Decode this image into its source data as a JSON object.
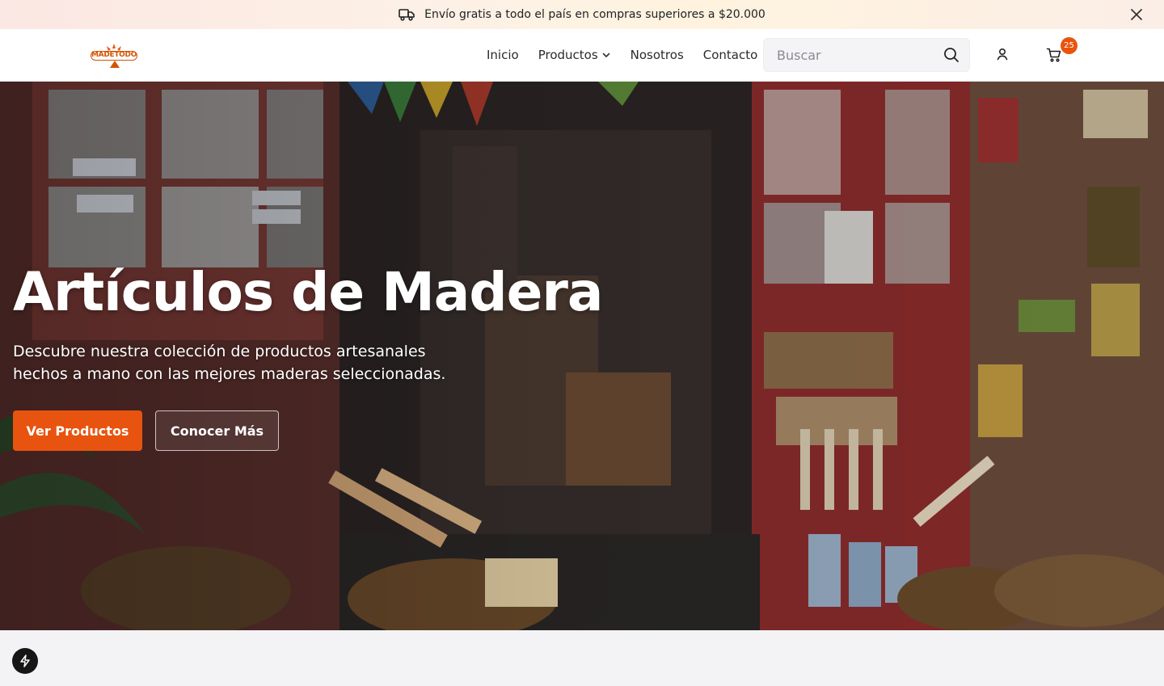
{
  "announcement": {
    "text": "Envío gratis a todo el país en compras superiores a $20.000",
    "icon": "truck-icon",
    "close_icon": "close-icon"
  },
  "header": {
    "logo_text": "MADETODO",
    "nav": [
      {
        "label": "Inicio"
      },
      {
        "label": "Productos",
        "icon": "chevron-down-icon"
      },
      {
        "label": "Nosotros"
      },
      {
        "label": "Contacto"
      }
    ],
    "search": {
      "placeholder": "Buscar",
      "value": "",
      "icon": "search-icon"
    },
    "user_icon": "user-icon",
    "cart": {
      "icon": "cart-icon",
      "count": "25"
    }
  },
  "hero": {
    "title": "Artículos de Madera",
    "subtitle": "Descubre nuestra colección de productos artesanales hechos a mano con las mejores maderas seleccionadas.",
    "primary_button": "Ver Productos",
    "secondary_button": "Conocer Más"
  },
  "floating": {
    "icon": "lightning-icon"
  },
  "colors": {
    "accent": "#e8540f",
    "brand": "#d35400"
  }
}
